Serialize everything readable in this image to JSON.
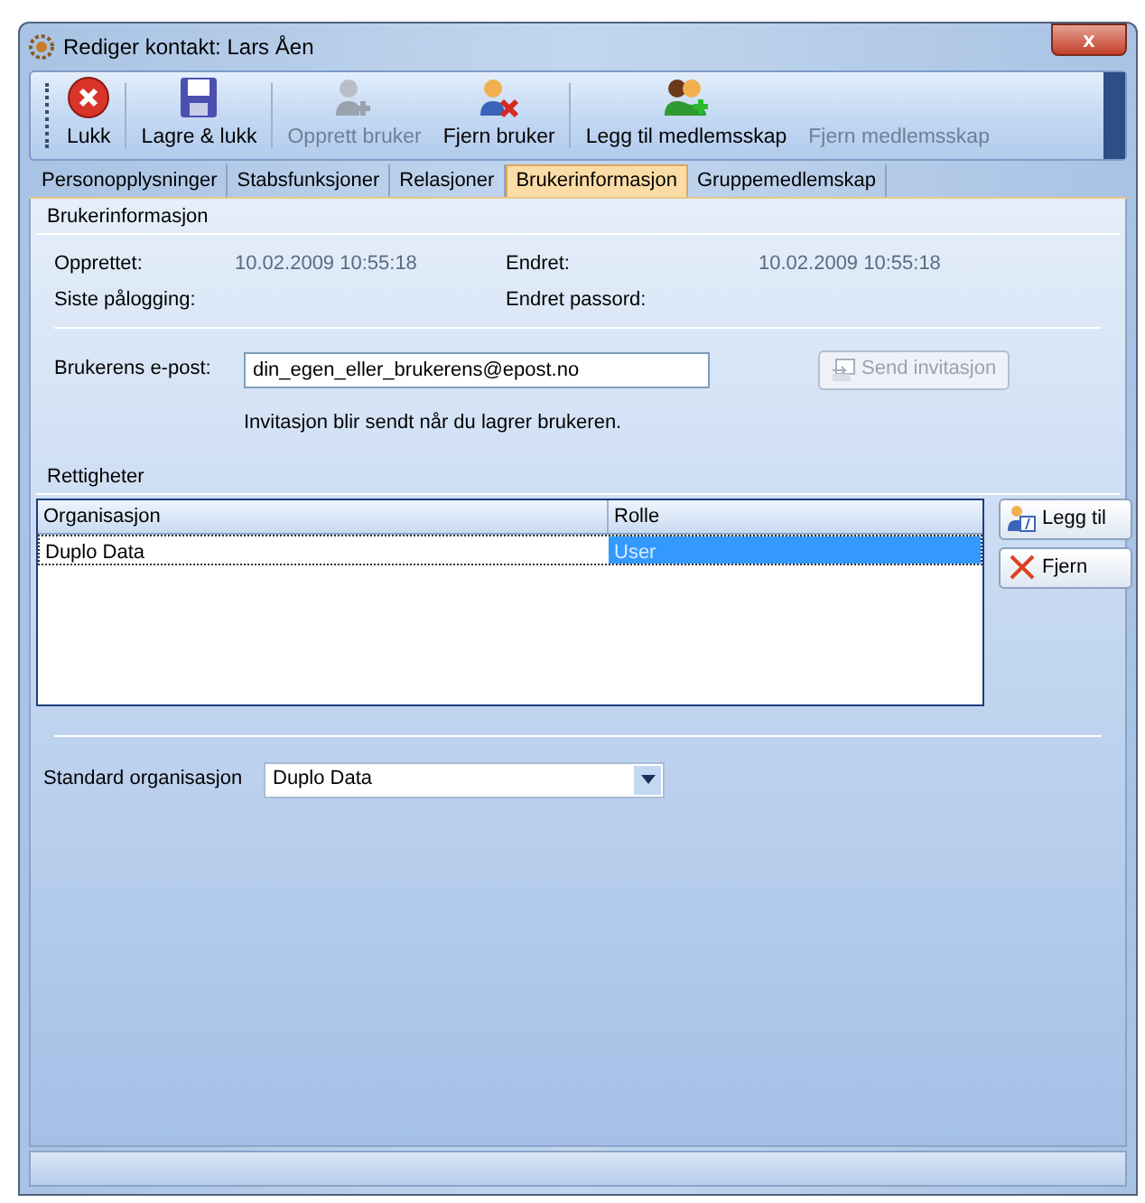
{
  "window": {
    "title": "Rediger kontakt: Lars Åen",
    "close": "x"
  },
  "toolbar": [
    {
      "label": "Lukk",
      "kind": "close",
      "disabled": false
    },
    {
      "label": "Lagre & lukk",
      "kind": "save",
      "disabled": false
    },
    {
      "label": "Opprett bruker",
      "kind": "add-user",
      "disabled": true
    },
    {
      "label": "Fjern bruker",
      "kind": "remove-user",
      "disabled": false
    },
    {
      "label": "Legg til medlemsskap",
      "kind": "add-group",
      "disabled": false
    },
    {
      "label": "Fjern medlemsskap",
      "kind": "none",
      "disabled": true
    }
  ],
  "tabs": [
    {
      "label": "Personopplysninger",
      "selected": false
    },
    {
      "label": "Stabsfunksjoner",
      "selected": false
    },
    {
      "label": "Relasjoner",
      "selected": false
    },
    {
      "label": "Brukerinformasjon",
      "selected": true
    },
    {
      "label": "Gruppemedlemskap",
      "selected": false
    }
  ],
  "user_info": {
    "title": "Brukerinformasjon",
    "fields": [
      {
        "label": "Opprettet:",
        "value": "10.02.2009 10:55:18"
      },
      {
        "label": "Endret:",
        "value": "10.02.2009 10:55:18"
      },
      {
        "label": "Siste pålogging:"
      },
      {
        "label": "Endret passord:"
      }
    ],
    "email_label": "Brukerens e-post:",
    "email": "din_egen_eller_brukerens@epost.no",
    "send_button": {
      "label": "Send invitasjon",
      "disabled": true
    },
    "note": "Invitasjon blir sendt når du lagrer brukeren."
  },
  "rights": {
    "title": "Rettigheter",
    "columns": [
      "Organisasjon",
      "Rolle"
    ],
    "rows": [
      {
        "cells": [
          "Duplo Data",
          "User"
        ],
        "selected": true
      }
    ],
    "buttons": [
      {
        "label": "Legg til",
        "kind": "add"
      },
      {
        "label": "Fjern",
        "kind": "remove"
      }
    ]
  },
  "default_org": {
    "label": "Standard organisasjon",
    "value": "Duplo Data"
  }
}
